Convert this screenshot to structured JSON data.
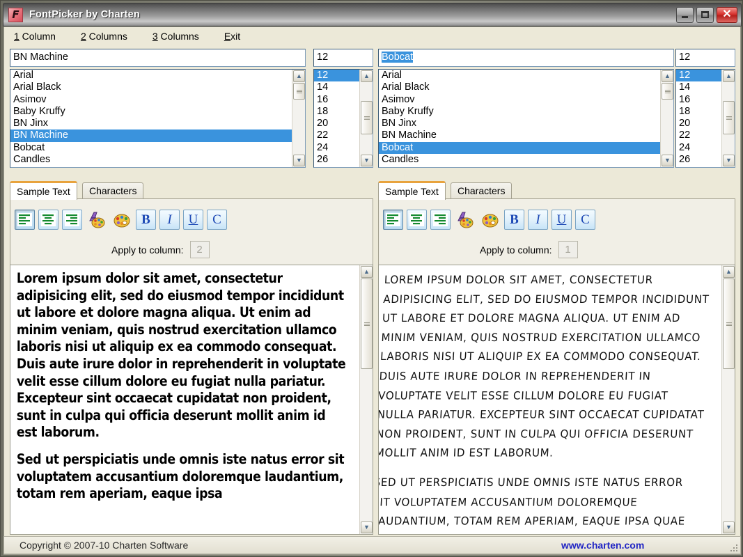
{
  "window": {
    "title": "FontPicker by Charten",
    "app_icon": "app-logo-icon",
    "minimize_label": "Minimize",
    "maximize_label": "Maximize",
    "close_label": "Close"
  },
  "menu": [
    {
      "accel": "1",
      "rest": " Column"
    },
    {
      "accel": "2",
      "rest": " Columns"
    },
    {
      "accel": "3",
      "rest": " Columns"
    },
    {
      "accel": "E",
      "rest": "xit"
    }
  ],
  "columns": [
    {
      "font_field_value": "BN Machine",
      "font_field_selected": false,
      "size_field_value": "12",
      "font_list": [
        "Arial",
        "Arial Black",
        "Asimov",
        "Baby Kruffy",
        "BN Jinx",
        "BN Machine",
        "Bobcat",
        "Candles"
      ],
      "font_selected": "BN Machine",
      "size_list": [
        "12",
        "14",
        "16",
        "18",
        "20",
        "22",
        "24",
        "26"
      ],
      "size_selected": "12",
      "tabs": [
        {
          "label": "Sample Text",
          "active": true
        },
        {
          "label": "Characters",
          "active": false
        }
      ],
      "apply_label": "Apply to column:",
      "apply_value": "2",
      "sample_paragraphs": [
        "Lorem ipsum dolor sit amet, consectetur adipisicing elit, sed do eiusmod tempor incididunt ut labore et dolore magna aliqua. Ut enim ad minim veniam, quis nostrud exercitation ullamco laboris nisi ut aliquip ex ea commodo consequat. Duis aute irure dolor in reprehenderit in voluptate velit esse cillum dolore eu fugiat nulla pariatur. Excepteur sint occaecat cupidatat non proident, sunt in culpa qui officia deserunt mollit anim id est laborum.",
        "Sed ut perspiciatis unde omnis iste natus error sit voluptatem accusantium doloremque laudantium, totam rem aperiam, eaque ipsa"
      ]
    },
    {
      "font_field_value": "Bobcat",
      "font_field_selected": true,
      "size_field_value": "12",
      "font_list": [
        "Arial",
        "Arial Black",
        "Asimov",
        "Baby Kruffy",
        "BN Jinx",
        "BN Machine",
        "Bobcat",
        "Candles"
      ],
      "font_selected": "Bobcat",
      "size_list": [
        "12",
        "14",
        "16",
        "18",
        "20",
        "22",
        "24",
        "26"
      ],
      "size_selected": "12",
      "tabs": [
        {
          "label": "Sample Text",
          "active": true
        },
        {
          "label": "Characters",
          "active": false
        }
      ],
      "apply_label": "Apply to column:",
      "apply_value": "1",
      "sample_paragraphs": [
        "Lorem ipsum dolor sit amet, consectetur adipisicing elit, sed do eiusmod tempor incididunt ut labore et dolore magna aliqua. Ut enim ad minim veniam, quis nostrud exercitation ullamco laboris nisi ut aliquip ex ea commodo consequat. Duis aute irure dolor in reprehenderit in voluptate velit esse cillum dolore eu fugiat nulla pariatur. Excepteur sint occaecat cupidatat non proident, sunt in culpa qui officia deserunt mollit anim id est laborum.",
        "Sed ut perspiciatis unde omnis iste natus error sit voluptatem accusantium doloremque laudantium, totam rem aperiam, eaque ipsa quae ab illo inventore veritatis"
      ]
    }
  ],
  "toolbar": {
    "buttons": [
      {
        "name": "align-left-icon",
        "kind": "align",
        "variant": "left",
        "pressed": true
      },
      {
        "name": "align-center-icon",
        "kind": "align",
        "variant": "center",
        "pressed": false
      },
      {
        "name": "align-right-icon",
        "kind": "align",
        "variant": "right",
        "pressed": false
      },
      {
        "name": "font-color-palette-icon",
        "kind": "palette-a",
        "pressed": false
      },
      {
        "name": "background-color-palette-icon",
        "kind": "palette",
        "pressed": false
      },
      {
        "name": "bold-button",
        "kind": "letter",
        "glyph": "B",
        "style": "bold",
        "pressed": false
      },
      {
        "name": "italic-button",
        "kind": "letter",
        "glyph": "I",
        "style": "italic",
        "pressed": false
      },
      {
        "name": "underline-button",
        "kind": "letter",
        "glyph": "U",
        "style": "underline",
        "pressed": false
      },
      {
        "name": "copy-button",
        "kind": "letter",
        "glyph": "C",
        "style": "plain",
        "pressed": false
      }
    ]
  },
  "statusbar": {
    "copyright": "Copyright © 2007-10 Charten Software",
    "website": "www.charten.com"
  },
  "colors": {
    "selection_blue": "#3a93dd",
    "tab_accent_orange": "#e8a33d",
    "link_blue": "#2024c4",
    "close_red": "#d8332e"
  }
}
